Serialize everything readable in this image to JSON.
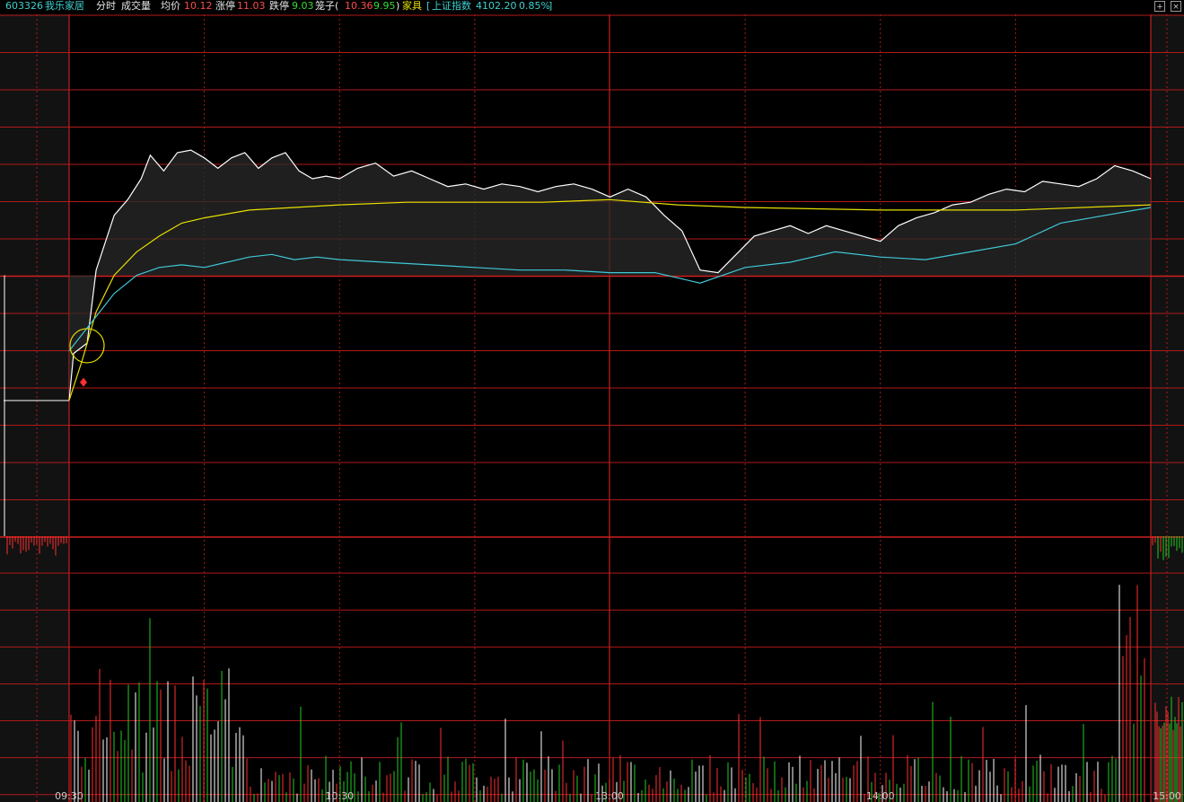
{
  "header": {
    "code": "603326",
    "name": "我乐家居",
    "tab_time": "分时",
    "tab_volume": "成交量",
    "avg_label": "均价",
    "avg_value": "10.12",
    "limit_up_label": "涨停",
    "limit_up_value": "11.03",
    "limit_down_label": "跌停",
    "limit_down_value": "9.03",
    "band_label": "笼子(",
    "band_high": "10.36",
    "band_low": "9.95",
    "band_close": ")",
    "industry": "家具",
    "index_open": "[",
    "index_name": "上证指数",
    "index_value": "4102.20",
    "index_change": "0.85%",
    "index_close": "]"
  },
  "icons": [
    "expand-icon",
    "close-icon"
  ],
  "colors": {
    "background": "#000000",
    "grid": "#b01a1a",
    "price_line": "#ffffff",
    "avg_line": "#e8e000",
    "index_line": "#3fc8d8",
    "up_volume": "#ff3030",
    "down_volume": "#22cc22",
    "neutral_volume": "#ffffff"
  },
  "chart_data": {
    "type": "line",
    "title": "",
    "time_labels": [
      "09:30",
      "10:30",
      "13:00",
      "14:00",
      "15:00"
    ],
    "session": "09:30-11:30, 13:00-15:00",
    "ylim": [
      9.03,
      11.03
    ],
    "preclose": 10.03,
    "series": [
      {
        "key": "price",
        "x": [
          "09:30",
          "09:31",
          "09:34",
          "09:36",
          "09:40",
          "09:43",
          "09:46",
          "09:48",
          "09:51",
          "09:54",
          "09:57",
          "10:00",
          "10:03",
          "10:06",
          "10:09",
          "10:12",
          "10:15",
          "10:18",
          "10:21",
          "10:24",
          "10:27",
          "10:30",
          "10:34",
          "10:38",
          "10:42",
          "10:46",
          "10:50",
          "10:54",
          "10:58",
          "11:02",
          "11:06",
          "11:10",
          "11:14",
          "11:18",
          "11:22",
          "11:26",
          "11:30",
          "13:04",
          "13:08",
          "13:12",
          "13:16",
          "13:20",
          "13:24",
          "13:28",
          "13:32",
          "13:36",
          "13:40",
          "13:44",
          "13:48",
          "13:52",
          "13:56",
          "14:00",
          "14:04",
          "14:08",
          "14:12",
          "14:16",
          "14:20",
          "14:24",
          "14:28",
          "14:32",
          "14:36",
          "14:40",
          "14:44",
          "14:48",
          "14:52",
          "14:56",
          "15:00"
        ],
        "values": [
          9.55,
          9.73,
          9.77,
          10.05,
          10.26,
          10.32,
          10.4,
          10.49,
          10.43,
          10.5,
          10.51,
          10.48,
          10.44,
          10.48,
          10.5,
          10.44,
          10.48,
          10.5,
          10.43,
          10.4,
          10.41,
          10.4,
          10.44,
          10.46,
          10.41,
          10.43,
          10.4,
          10.37,
          10.38,
          10.36,
          10.38,
          10.37,
          10.35,
          10.37,
          10.38,
          10.36,
          10.33,
          10.36,
          10.33,
          10.26,
          10.2,
          10.05,
          10.04,
          10.11,
          10.18,
          10.2,
          10.22,
          10.19,
          10.22,
          10.2,
          10.18,
          10.16,
          10.22,
          10.25,
          10.27,
          10.3,
          10.31,
          10.34,
          10.36,
          10.35,
          10.39,
          10.38,
          10.37,
          10.4,
          10.45,
          10.43,
          10.4
        ]
      },
      {
        "key": "average",
        "x": [
          "09:30",
          "09:33",
          "09:36",
          "09:40",
          "09:45",
          "09:50",
          "09:55",
          "10:00",
          "10:10",
          "10:20",
          "10:30",
          "10:45",
          "11:00",
          "11:15",
          "11:30",
          "13:15",
          "13:30",
          "14:00",
          "14:30",
          "15:00"
        ],
        "values": [
          9.55,
          9.71,
          9.89,
          10.03,
          10.12,
          10.18,
          10.23,
          10.25,
          10.28,
          10.29,
          10.3,
          10.31,
          10.31,
          10.31,
          10.32,
          10.3,
          10.29,
          10.28,
          10.28,
          10.3
        ]
      },
      {
        "key": "index",
        "x": [
          "09:30",
          "09:35",
          "09:40",
          "09:45",
          "09:50",
          "09:55",
          "10:00",
          "10:05",
          "10:10",
          "10:15",
          "10:20",
          "10:25",
          "10:30",
          "10:40",
          "10:50",
          "11:00",
          "11:10",
          "11:20",
          "11:30",
          "13:10",
          "13:20",
          "13:30",
          "13:40",
          "13:50",
          "14:00",
          "14:10",
          "14:20",
          "14:30",
          "14:40",
          "14:50",
          "15:00"
        ],
        "values": [
          9.74,
          9.85,
          9.96,
          10.03,
          10.06,
          10.07,
          10.06,
          10.08,
          10.1,
          10.11,
          10.09,
          10.1,
          10.09,
          10.08,
          10.07,
          10.06,
          10.05,
          10.05,
          10.04,
          10.04,
          10.0,
          10.06,
          10.08,
          10.12,
          10.1,
          10.09,
          10.12,
          10.15,
          10.23,
          10.26,
          10.29
        ]
      }
    ],
    "volume": {
      "unit": "relative",
      "max": 100
    }
  }
}
